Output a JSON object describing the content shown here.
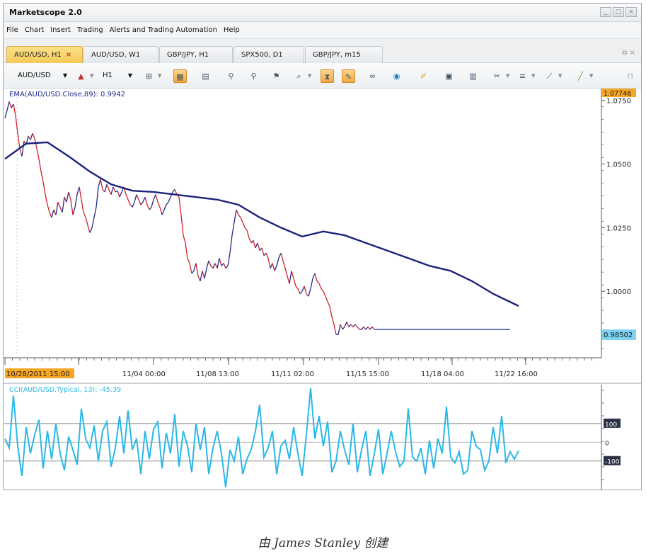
{
  "app": {
    "title": "Marketscope 2.0"
  },
  "window_buttons": [
    "_",
    "□",
    "×"
  ],
  "menu": [
    "File",
    "Chart",
    "Insert",
    "Trading",
    "Alerts and Trading Automation",
    "Help"
  ],
  "tabs": [
    {
      "label": "AUD/USD, H1",
      "active": true,
      "closable": true
    },
    {
      "label": "AUD/USD, W1",
      "active": false
    },
    {
      "label": "GBP/JPY, H1",
      "active": false
    },
    {
      "label": "SPX500, D1",
      "active": false
    },
    {
      "label": "GBP/JPY, m15",
      "active": false
    }
  ],
  "toolbar": {
    "instrument": "AUD/USD",
    "timeframe": "H1",
    "icons": [
      "candle-type-icon",
      "chart-style-icon",
      "price-panel-icon",
      "indicator-panel-icon",
      "add-indicator-icon",
      "remove-indicator-icon",
      "signal-icon",
      "zoom-icon",
      "hourglass-icon",
      "note-icon",
      "link-icon",
      "globe-icon",
      "pencil-icon",
      "image-icon",
      "layout-icon",
      "tools-icon",
      "lines-icon",
      "fan-icon",
      "trendline-icon",
      "pin-icon"
    ]
  },
  "chart_data": [
    {
      "type": "line",
      "title": "EMA(AUD/USD.Close,89): 0.9942",
      "description_series": [
        "AUD/USD H1 price",
        "EMA(AUD/USD.Close,89)"
      ],
      "x_ticks": [
        "10/28/2011 15:00",
        "11/04 00:00",
        "11/08 13:00",
        "11/11 02:00",
        "11/15 15:00",
        "11/18 04:00",
        "11/22 16:00"
      ],
      "y_ticks": [
        "1.0750",
        "1.0500",
        "1.0250",
        "1.0000"
      ],
      "ylim": [
        0.975,
        1.0785
      ],
      "top_label": "1.07746",
      "current_price": "0.98502",
      "colors": {
        "price_up": "#1f2a8c",
        "price_down": "#d0202a",
        "ema": "#1b237a",
        "current_price_bg": "#7fd3f0",
        "top_label_bg": "#f6a623"
      },
      "price_x": [
        0,
        3,
        6,
        9,
        12,
        15,
        18,
        21,
        24,
        27,
        30,
        33,
        36,
        39,
        42,
        45,
        48,
        51,
        54,
        57,
        60,
        63,
        66,
        69,
        72,
        75,
        78,
        81,
        84,
        87,
        90,
        93,
        96,
        99,
        102,
        105,
        108,
        111,
        114,
        117,
        120,
        123,
        126,
        129,
        132,
        135,
        138,
        141,
        144,
        147,
        150,
        153,
        156,
        159,
        162,
        165,
        168,
        171,
        174,
        177,
        180,
        183,
        186,
        189,
        192,
        195,
        198,
        201,
        204,
        207,
        210,
        213,
        216,
        219,
        222,
        225,
        228,
        231,
        234,
        237,
        240,
        243,
        246,
        249,
        252,
        255,
        258,
        261,
        264,
        267,
        270,
        273,
        276,
        279,
        282,
        285,
        288,
        291,
        294,
        297,
        300,
        303,
        306,
        309,
        312,
        315,
        318,
        321,
        324,
        327,
        330,
        333,
        336,
        339,
        342,
        345,
        348,
        351,
        354,
        357,
        360,
        363,
        366,
        369,
        372,
        375,
        378,
        381,
        384,
        387,
        390,
        393,
        396,
        399,
        402,
        405,
        408,
        411,
        414,
        417,
        420,
        423,
        426,
        429,
        432,
        435,
        438,
        441,
        444,
        447,
        450,
        453,
        456,
        459,
        462,
        465,
        468,
        471,
        474,
        477,
        480,
        483,
        486,
        489,
        492,
        495,
        498,
        501,
        504,
        507,
        510,
        513,
        516,
        519,
        522,
        525,
        528,
        531,
        534,
        537,
        540,
        543,
        546,
        549,
        552,
        555,
        558,
        561,
        564,
        567,
        570,
        573,
        576,
        579,
        582,
        585,
        588,
        591,
        594,
        597,
        600,
        603,
        606,
        609,
        612,
        615,
        618,
        621,
        624,
        627,
        630,
        633,
        636,
        639,
        642,
        645,
        648,
        651,
        654,
        657,
        660,
        663,
        666,
        669,
        672,
        675,
        678,
        681,
        684,
        687,
        690,
        693,
        696,
        699,
        702,
        705,
        708,
        711,
        714,
        717,
        720,
        723,
        726
      ],
      "price_values": [
        1.068,
        1.071,
        1.0745,
        1.072,
        1.0735,
        1.069,
        1.062,
        1.056,
        1.053,
        1.059,
        1.0575,
        1.061,
        1.0595,
        1.062,
        1.06,
        1.056,
        1.052,
        1.047,
        1.043,
        1.038,
        1.034,
        1.031,
        1.029,
        1.032,
        1.03,
        1.035,
        1.033,
        1.031,
        1.037,
        1.035,
        1.039,
        1.036,
        1.03,
        1.033,
        1.038,
        1.041,
        1.036,
        1.031,
        1.029,
        1.026,
        1.023,
        1.025,
        1.029,
        1.033,
        1.041,
        1.044,
        1.04,
        1.039,
        1.042,
        1.04,
        1.038,
        1.041,
        1.039,
        1.0395,
        1.037,
        1.039,
        1.041,
        1.038,
        1.036,
        1.034,
        1.033,
        1.035,
        1.038,
        1.036,
        1.034,
        1.035,
        1.037,
        1.034,
        1.032,
        1.033,
        1.036,
        1.038,
        1.035,
        1.033,
        1.03,
        1.032,
        1.034,
        1.035,
        1.037,
        1.039,
        1.04,
        1.038,
        1.037,
        1.03,
        1.022,
        1.019,
        1.013,
        1.011,
        1.007,
        1.008,
        1.011,
        1.006,
        1.004,
        1.008,
        1.005,
        1.009,
        1.012,
        1.01,
        1.009,
        1.011,
        1.009,
        1.013,
        1.01,
        1.011,
        1.009,
        1.01,
        1.015,
        1.022,
        1.027,
        1.032,
        1.03,
        1.029,
        1.027,
        1.025,
        1.024,
        1.021,
        1.019,
        1.02,
        1.017,
        1.019,
        1.016,
        1.017,
        1.014,
        1.015,
        1.013,
        1.009,
        1.011,
        1.008,
        1.01,
        1.013,
        1.015,
        1.012,
        1.009,
        1.006,
        1.003,
        1.008,
        1.005,
        1.002,
        1.001,
        0.999,
        1.0,
        1.002,
        0.999,
        0.998,
        1.001,
        1.005,
        1.007,
        1.004,
        1.003,
        1.001,
        1.0,
        0.998,
        0.996,
        0.994,
        0.99,
        0.987,
        0.983,
        0.983,
        0.987,
        0.985,
        0.986,
        0.988,
        0.986,
        0.987,
        0.986,
        0.987,
        0.986,
        0.985,
        0.985,
        0.986,
        0.985,
        0.986,
        0.985,
        0.986,
        0.985,
        0.985,
        0.985,
        0.985,
        0.985,
        0.985,
        0.985,
        0.985,
        0.985,
        0.985,
        0.985,
        0.985,
        0.985,
        0.985,
        0.985,
        0.985,
        0.985,
        0.985,
        0.985,
        0.985,
        0.985,
        0.985,
        0.985,
        0.985,
        0.985,
        0.985,
        0.985,
        0.985,
        0.985,
        0.985,
        0.985,
        0.985,
        0.985,
        0.985,
        0.985,
        0.985,
        0.985,
        0.985,
        0.985,
        0.985,
        0.985,
        0.985,
        0.985,
        0.985,
        0.985,
        0.985,
        0.985,
        0.985,
        0.985,
        0.985,
        0.985,
        0.985,
        0.985,
        0.985,
        0.985,
        0.985,
        0.985,
        0.985,
        0.985,
        0.985,
        0.985,
        0.985,
        0.985,
        0.985,
        0.985
      ],
      "ema_x": [
        0,
        30,
        60,
        90,
        120,
        150,
        180,
        210,
        240,
        270,
        300,
        330,
        360,
        390,
        420,
        450,
        480,
        510,
        540,
        570,
        600,
        630,
        660,
        690,
        726
      ],
      "ema_values": [
        1.052,
        1.058,
        1.0585,
        1.053,
        1.047,
        1.042,
        1.0395,
        1.039,
        1.038,
        1.037,
        1.036,
        1.034,
        1.029,
        1.025,
        1.0215,
        1.0235,
        1.022,
        1.019,
        1.016,
        1.013,
        1.01,
        1.008,
        1.004,
        0.999,
        0.9942
      ]
    },
    {
      "type": "line",
      "title": "CCI(AUD/USD.Typical, 13): -45.39",
      "y_ticks": [
        "100",
        "0",
        "-100"
      ],
      "ylim": [
        -260,
        300
      ],
      "color": "#2ab8e8",
      "x": [
        0,
        6,
        12,
        18,
        24,
        30,
        36,
        42,
        48,
        54,
        60,
        66,
        72,
        78,
        84,
        90,
        96,
        102,
        108,
        114,
        120,
        126,
        132,
        138,
        144,
        150,
        156,
        162,
        168,
        174,
        180,
        186,
        192,
        198,
        204,
        210,
        216,
        222,
        228,
        234,
        240,
        246,
        252,
        258,
        264,
        270,
        276,
        282,
        288,
        294,
        300,
        306,
        312,
        318,
        324,
        330,
        336,
        342,
        348,
        354,
        360,
        366,
        372,
        378,
        384,
        390,
        396,
        402,
        408,
        414,
        420,
        426,
        432,
        438,
        444,
        450,
        456,
        462,
        468,
        474,
        480,
        486,
        492,
        498,
        504,
        510,
        516,
        522,
        528,
        534,
        540,
        546,
        552,
        558,
        564,
        570,
        576,
        582,
        588,
        594,
        600,
        606,
        612,
        618,
        624,
        630,
        636,
        642,
        648,
        654,
        660,
        666,
        672,
        678,
        684,
        690,
        696,
        702,
        708,
        714,
        720,
        726
      ],
      "values": [
        20,
        -30,
        250,
        -20,
        -180,
        80,
        -60,
        40,
        120,
        -140,
        60,
        -90,
        100,
        -60,
        -150,
        30,
        -40,
        -120,
        180,
        20,
        -30,
        90,
        -100,
        60,
        110,
        -130,
        -30,
        140,
        -60,
        170,
        -40,
        20,
        -170,
        60,
        -90,
        70,
        110,
        -140,
        50,
        -60,
        150,
        -130,
        60,
        -20,
        -160,
        100,
        -40,
        80,
        -170,
        -30,
        60,
        -60,
        -240,
        -40,
        -100,
        30,
        -170,
        -90,
        -40,
        60,
        200,
        -80,
        -30,
        60,
        -170,
        -20,
        10,
        -90,
        80,
        -60,
        -180,
        40,
        290,
        20,
        140,
        -20,
        110,
        -160,
        -100,
        60,
        -40,
        -120,
        100,
        -160,
        -40,
        60,
        -180,
        -60,
        70,
        -170,
        -60,
        60,
        -50,
        -130,
        -100,
        180,
        -80,
        -100,
        -30,
        -170,
        10,
        -140,
        20,
        -60,
        190,
        -80,
        -110,
        -50,
        -170,
        -150,
        60,
        -20,
        -40,
        -150,
        -100,
        80,
        -60,
        140,
        -110,
        -50,
        -90,
        -45
      ]
    }
  ],
  "caption": "由 James Stanley 创建"
}
